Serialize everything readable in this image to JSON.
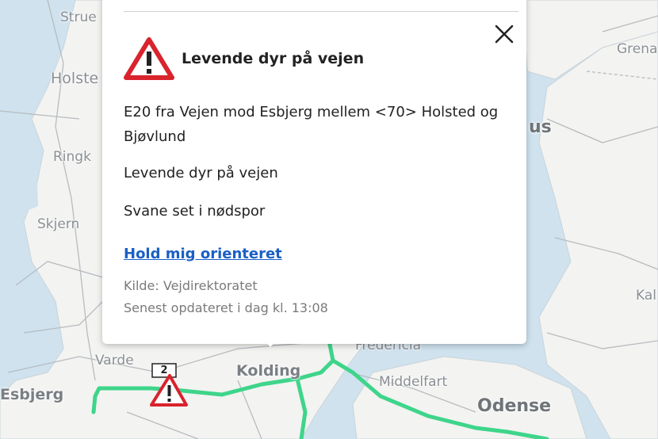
{
  "map": {
    "labels": {
      "struer": "Strue",
      "holstebro": "Holste",
      "ringkobing": "Ringk",
      "skjern": "Skjern",
      "varde": "Varde",
      "esbjerg": "Esbjerg",
      "kolding": "Kolding",
      "fredericia": "Fredericia",
      "middelfart": "Middelfart",
      "odense": "Odense",
      "grenaa": "Grena",
      "aarhus": "us",
      "kalundborg": "Kal"
    },
    "marker_count": "2"
  },
  "popup": {
    "title": "Levende dyr på vejen",
    "location": "E20 fra Vejen mod Esbjerg mellem <70> Holsted og Bjøvlund",
    "event": "Levende dyr på vejen",
    "detail": "Svane set i nødspor",
    "follow_link": "Hold mig orienteret",
    "source": "Kilde: Vejdirektoratet",
    "updated": "Senest opdateret i dag kl. 13:08"
  },
  "colors": {
    "route": "#3ed58a",
    "warning_red": "#d9232d",
    "link": "#1a5fc6",
    "water": "#cfe2ee",
    "land": "#f3f3f1"
  }
}
